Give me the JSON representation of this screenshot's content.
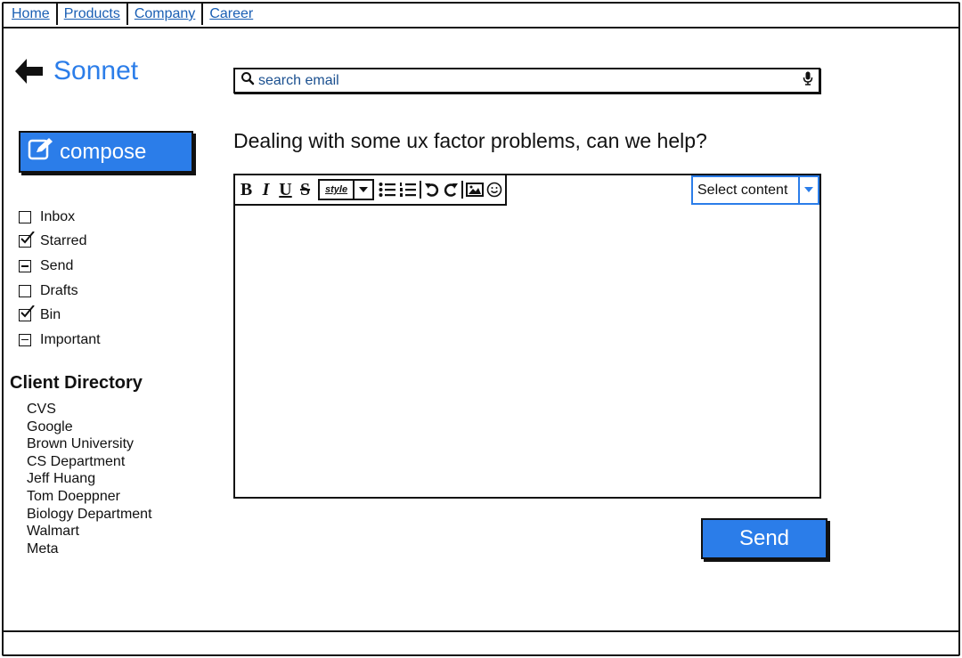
{
  "nav": {
    "links": [
      "Home",
      "Products",
      "Company",
      "Career"
    ]
  },
  "app": {
    "title": "Sonnet"
  },
  "compose": {
    "label": "compose"
  },
  "search": {
    "placeholder": "search email"
  },
  "folders": [
    {
      "label": "Inbox",
      "state": "unchecked"
    },
    {
      "label": "Starred",
      "state": "checked"
    },
    {
      "label": "Send",
      "state": "indeterminate"
    },
    {
      "label": "Drafts",
      "state": "unchecked"
    },
    {
      "label": "Bin",
      "state": "checked"
    },
    {
      "label": "Important",
      "state": "indeterminate"
    }
  ],
  "directory": {
    "title": "Client Directory",
    "clients": [
      "CVS",
      "Google",
      "Brown University",
      "CS Department",
      "Jeff Huang",
      "Tom Doeppner",
      "Biology Department",
      "Walmart",
      "Meta"
    ]
  },
  "main": {
    "headline": "Dealing with some ux factor problems, can we help?"
  },
  "editor": {
    "bold": "B",
    "italic": "I",
    "underline": "U",
    "strike": "S",
    "style_label": "style",
    "select_label": "Select content"
  },
  "send": {
    "label": "Send"
  },
  "colors": {
    "accent": "#2b7de9",
    "link": "#1a5fb4",
    "border": "#111111"
  }
}
